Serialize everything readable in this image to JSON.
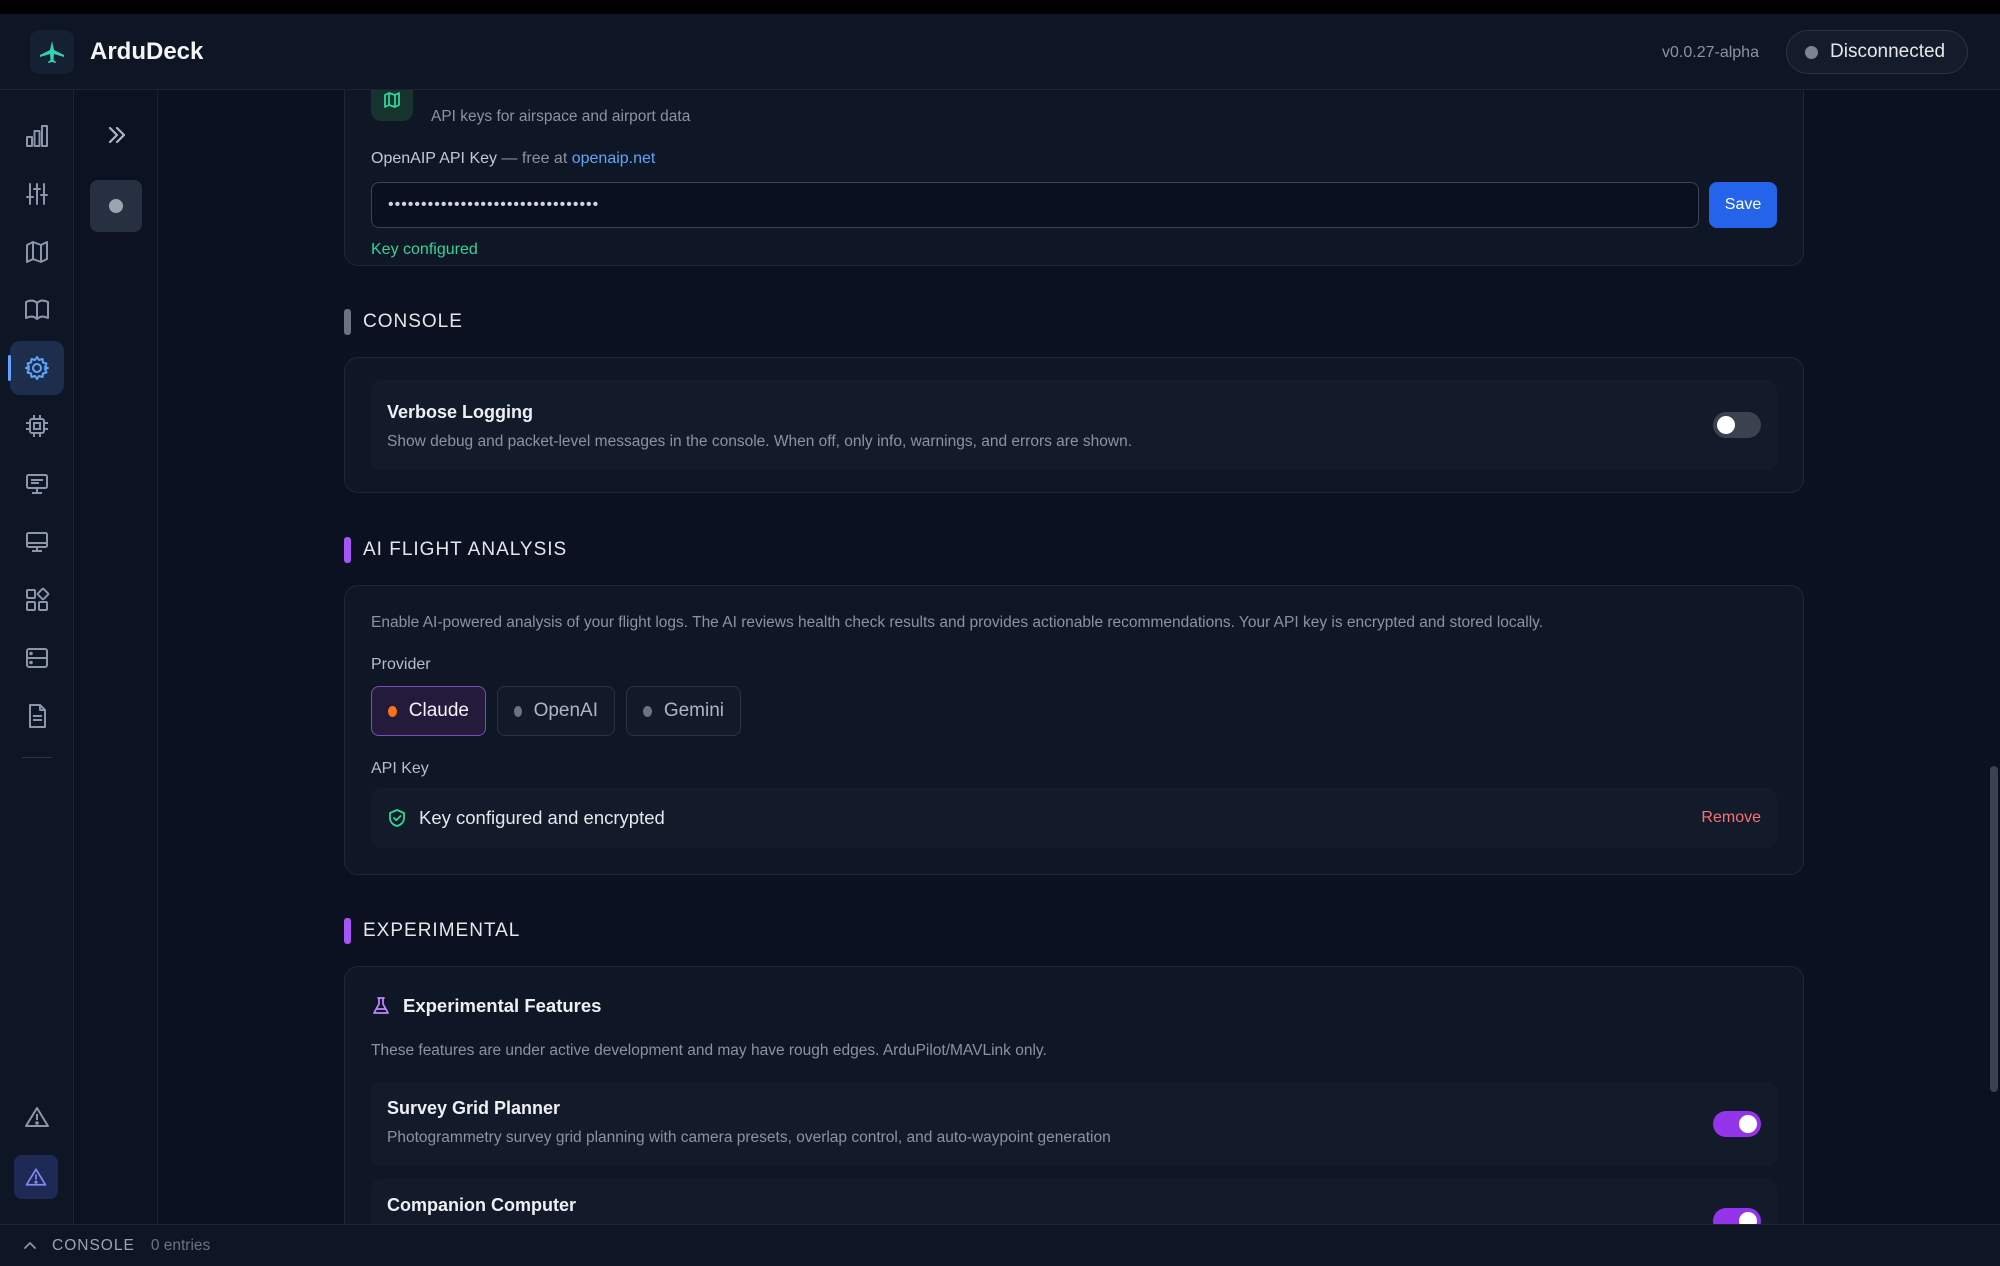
{
  "header": {
    "app_title": "ArduDeck",
    "version": "v0.0.27-alpha",
    "connection_status": "Disconnected"
  },
  "sidebar": {
    "icons": [
      "dashboard-chart-icon",
      "tuning-sliders-icon",
      "map-icon",
      "book-icon",
      "settings-gear-icon",
      "cpu-chip-icon",
      "monitor-desk-icon",
      "monitor-icon",
      "modules-grid-icon",
      "storage-icon",
      "document-icon",
      "warning-triangle-icon",
      "alert-triangle-icon"
    ],
    "active": "settings-gear-icon"
  },
  "map_api": {
    "subtitle": "API keys for airspace and airport data",
    "key_label": "OpenAIP API Key",
    "key_hint": "— free at",
    "key_link": "openaip.net",
    "key_value": "••••••••••••••••••••••••••••••••",
    "save_label": "Save",
    "status": "Key configured"
  },
  "console": {
    "section_title": "CONSOLE",
    "verbose_title": "Verbose Logging",
    "verbose_desc": "Show debug and packet-level messages in the console. When off, only info, warnings, and errors are shown.",
    "verbose_enabled": false
  },
  "ai": {
    "section_title": "AI FLIGHT ANALYSIS",
    "description": "Enable AI-powered analysis of your flight logs. The AI reviews health check results and provides actionable recommendations. Your API key is encrypted and stored locally.",
    "provider_label": "Provider",
    "providers": [
      "Claude",
      "OpenAI",
      "Gemini"
    ],
    "selected_provider": "Claude",
    "api_key_label": "API Key",
    "key_status": "Key configured and encrypted",
    "remove_label": "Remove"
  },
  "experimental": {
    "section_title": "EXPERIMENTAL",
    "card_title": "Experimental Features",
    "description": "These features are under active development and may have rough edges. ArduPilot/MAVLink only.",
    "features": [
      {
        "title": "Survey Grid Planner",
        "desc": "Photogrammetry survey grid planning with camera presets, overlap control, and auto-waypoint generation",
        "enabled": true
      },
      {
        "title": "Companion Computer",
        "enabled": true
      }
    ]
  },
  "footer": {
    "console_label": "CONSOLE",
    "entries": "0 entries"
  },
  "colors": {
    "accent_blue": "#2563eb",
    "success_green": "#34d399",
    "danger_red": "#f87171",
    "purple": "#9333ea",
    "claude_orange": "#f97316"
  }
}
